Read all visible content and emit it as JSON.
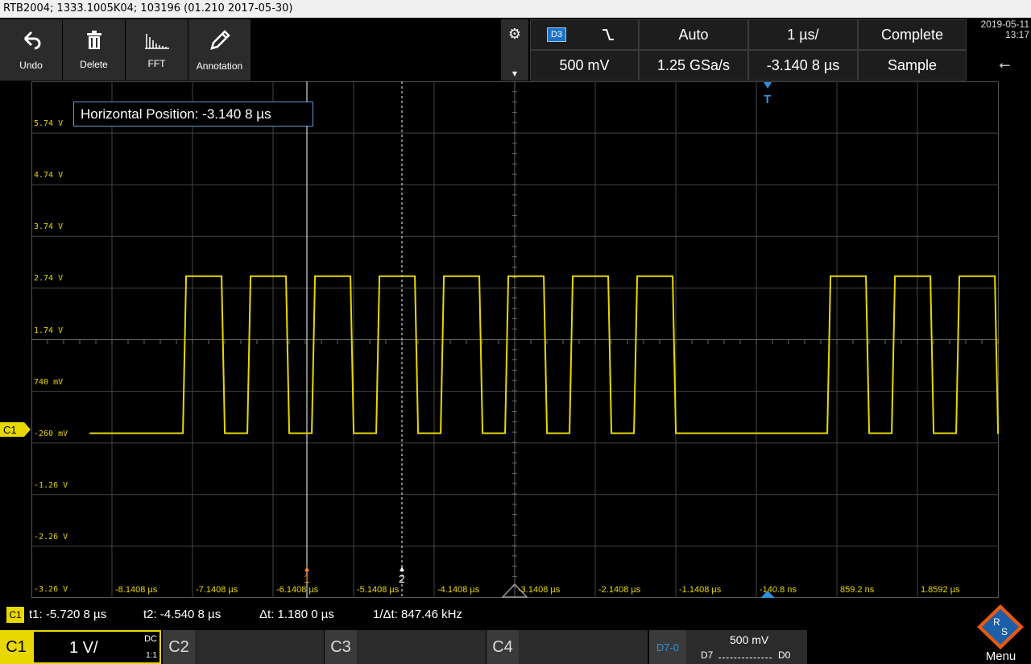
{
  "title": "RTB2004; 1333.1005K04; 103196 (01.210 2017-05-30)",
  "toolbar": {
    "undo": "Undo",
    "delete": "Delete",
    "fft": "FFT",
    "annotation": "Annotation"
  },
  "settings": {
    "channel": "D3",
    "trigger_mode": "Auto",
    "timebase": "1 µs/",
    "acq_state": "Complete",
    "vertical_scale": "500 mV",
    "sample_rate": "1.25 GSa/s",
    "horizontal_position": "-3.140 8 µs",
    "acq_mode": "Sample"
  },
  "datetime": {
    "date": "2019-05-11",
    "time": "13:17"
  },
  "y_labels": [
    "5.74 V",
    "4.74 V",
    "3.74 V",
    "2.74 V",
    "1.74 V",
    "740 mV",
    "-260 mV",
    "-1.26 V",
    "-2.26 V",
    "-3.26 V"
  ],
  "x_labels": [
    "-8.1408 µs",
    "-7.1408 µs",
    "-6.1408 µs",
    "-5.1408 µs",
    "-4.1408 µs",
    "-3.1408 µs",
    "-2.1408 µs",
    "-1.1408 µs",
    "-140.8 ns",
    "859.2 ns",
    "1.8592 µs"
  ],
  "cursor_markers": [
    "1",
    "2"
  ],
  "trigger_marker": "T",
  "info_box": "Horizontal Position: -3.140 8 µs",
  "waveform": {
    "channel": "C1",
    "color": "#e8d800",
    "low_level_v": -0.26,
    "high_level_v": 2.78,
    "pulses_us": [
      [
        -7.26,
        -6.78
      ],
      [
        -6.46,
        -5.98
      ],
      [
        -5.66,
        -5.18
      ],
      [
        -4.86,
        -4.38
      ],
      [
        -4.06,
        -3.58
      ],
      [
        -3.26,
        -2.78
      ],
      [
        -2.46,
        -1.98
      ],
      [
        -1.66,
        -1.18
      ],
      [
        0.74,
        1.22
      ],
      [
        1.54,
        2.02
      ],
      [
        2.34,
        2.82
      ]
    ],
    "x_start_us": -8.42,
    "x_end_us": 3.02
  },
  "cursors": {
    "badge": "C1",
    "t1": "t1: -5.720 8 µs",
    "t2": "t2: -4.540 8 µs",
    "dt": "Δt: 1.180 0 µs",
    "inv_dt": "1/Δt: 847.46 kHz"
  },
  "channels": {
    "c1": {
      "label": "C1",
      "value": "1 V/",
      "coupling": "DC",
      "ratio": "1:1"
    },
    "c2": {
      "label": "C2"
    },
    "c3": {
      "label": "C3"
    },
    "c4": {
      "label": "C4"
    },
    "digital": {
      "label": "D7-0",
      "value": "500 mV",
      "msb": "D7",
      "lsb": "D0"
    }
  },
  "menu_label": "Menu"
}
